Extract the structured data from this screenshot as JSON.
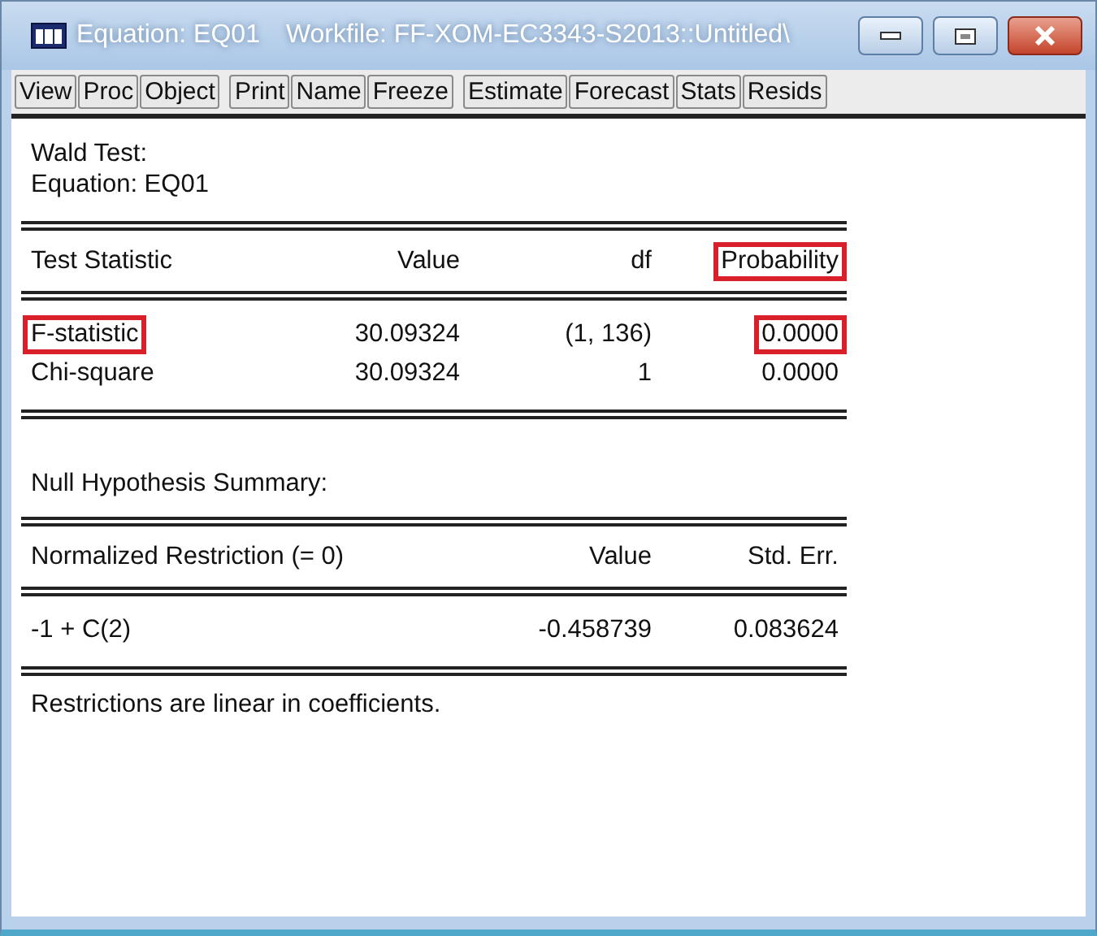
{
  "window": {
    "title": "Equation: EQ01",
    "workfile": "Workfile: FF-XOM-EC3343-S2013::Untitled\\"
  },
  "toolbar": [
    [
      "View",
      "Proc",
      "Object"
    ],
    [
      "Print",
      "Name",
      "Freeze"
    ],
    [
      "Estimate",
      "Forecast",
      "Stats",
      "Resids"
    ]
  ],
  "heading": [
    "Wald Test:",
    "Equation: EQ01"
  ],
  "test_table": {
    "columns": [
      {
        "text": "Test Statistic",
        "highlighted": false
      },
      {
        "text": "Value",
        "highlighted": false
      },
      {
        "text": "df",
        "highlighted": false
      },
      {
        "text": "Probability",
        "highlighted": true
      }
    ],
    "rows": [
      [
        {
          "text": "F-statistic",
          "highlighted": true
        },
        {
          "text": "30.09324",
          "highlighted": false
        },
        {
          "text": "(1, 136)",
          "highlighted": false
        },
        {
          "text": "0.0000",
          "highlighted": true
        }
      ],
      [
        {
          "text": "Chi-square",
          "highlighted": false
        },
        {
          "text": "30.09324",
          "highlighted": false
        },
        {
          "text": "1",
          "highlighted": false
        },
        {
          "text": "0.0000",
          "highlighted": false
        }
      ]
    ]
  },
  "summary_title": "Null Hypothesis Summary:",
  "summary_table": {
    "columns": [
      "Normalized Restriction (= 0)",
      "Value",
      "Std. Err."
    ],
    "rows": [
      [
        "-1 + C(2)",
        "-0.458739",
        "0.083624"
      ]
    ]
  },
  "footer": "Restrictions are linear in coefficients."
}
